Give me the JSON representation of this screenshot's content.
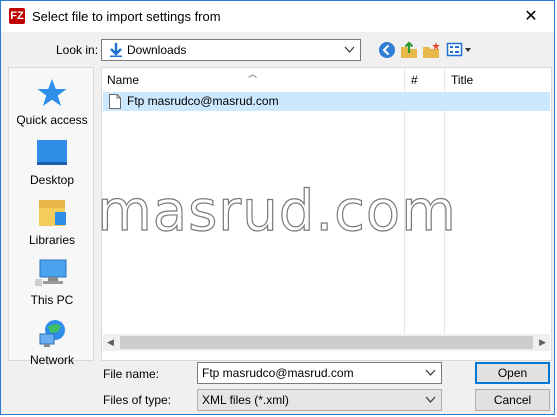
{
  "window": {
    "title": "Select file to import settings from",
    "app_icon_text": "FZ"
  },
  "toolbar": {
    "look_in_label": "Look in:",
    "look_in_value": "Downloads",
    "buttons": [
      "back-icon",
      "up-folder-icon",
      "new-folder-icon",
      "view-menu-icon"
    ]
  },
  "places": [
    {
      "label": "Quick access",
      "icon": "star-icon"
    },
    {
      "label": "Desktop",
      "icon": "desktop-icon"
    },
    {
      "label": "Libraries",
      "icon": "libraries-icon"
    },
    {
      "label": "This PC",
      "icon": "computer-icon"
    },
    {
      "label": "Network",
      "icon": "network-icon"
    }
  ],
  "file_list": {
    "columns": [
      "Name",
      "#",
      "Title"
    ],
    "rows": [
      {
        "name": "Ftp masrudco@masrud.com",
        "selected": true
      }
    ]
  },
  "form": {
    "file_name_label": "File name:",
    "file_name_value": "Ftp masrudco@masrud.com",
    "file_type_label": "Files of type:",
    "file_type_value": "XML files (*.xml)"
  },
  "buttons": {
    "open": "Open",
    "cancel": "Cancel"
  },
  "watermark": "masrud.com",
  "colors": {
    "accent": "#0078d7",
    "selection": "#cce8ff",
    "window_border": "#2b79d7"
  }
}
